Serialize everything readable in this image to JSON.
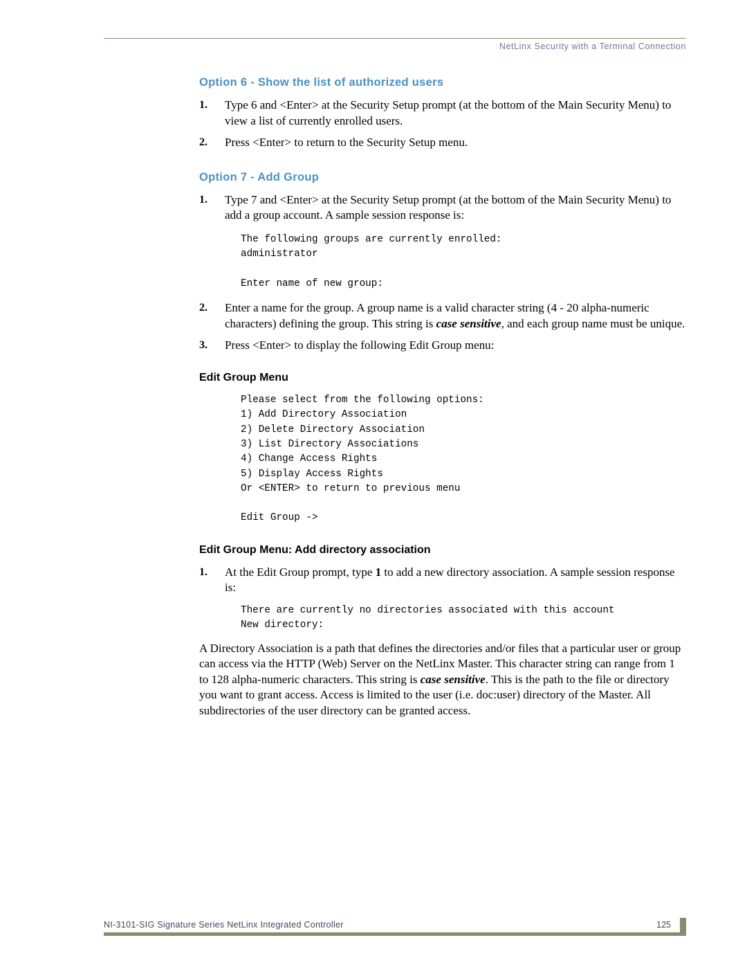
{
  "header": {
    "running_head": "NetLinx Security with a Terminal Connection"
  },
  "sections": {
    "option6": {
      "title": "Option 6 - Show the list of authorized users",
      "steps": [
        {
          "num": "1.",
          "text": "Type 6 and <Enter> at the Security Setup prompt (at the bottom of the Main Security Menu) to view a list of currently enrolled users."
        },
        {
          "num": "2.",
          "text": "Press <Enter> to return to the Security Setup menu."
        }
      ]
    },
    "option7": {
      "title": "Option 7 - Add Group",
      "step1": {
        "num": "1.",
        "text": "Type 7 and <Enter> at the Security Setup prompt (at the bottom of the Main Security Menu) to add a group account. A sample session response is:"
      },
      "terminal1": "The following groups are currently enrolled:\nadministrator\n\nEnter name of new group:",
      "step2": {
        "num": "2.",
        "text_before": "Enter a name for the group. A group name is a valid character string (4 - 20 alpha-numeric characters) defining the group. This string is ",
        "emphasis": "case sensitive",
        "text_after": ", and each group name must be unique."
      },
      "step3": {
        "num": "3.",
        "text": "Press <Enter> to display the following Edit Group menu:"
      }
    },
    "edit_group_menu": {
      "title": "Edit Group Menu",
      "terminal": "Please select from the following options:\n1) Add Directory Association\n2) Delete Directory Association\n3) List Directory Associations\n4) Change Access Rights\n5) Display Access Rights\nOr <ENTER> to return to previous menu\n\nEdit Group ->"
    },
    "add_directory_association": {
      "title": "Edit Group Menu: Add directory association",
      "step1": {
        "num": "1.",
        "text_before": "At the Edit Group prompt, type ",
        "emphasis": "1",
        "text_after": " to add a new directory association. A sample session response is:"
      },
      "terminal": "There are currently no directories associated with this account\nNew directory:",
      "paragraph_before": "A Directory Association is a path that defines the directories and/or files that a particular user or group can access via the HTTP (Web) Server on the NetLinx Master. This character string can range from 1 to 128 alpha-numeric characters. This string is ",
      "paragraph_emphasis": "case sensitive",
      "paragraph_after": ". This is the path to the file or directory you want to grant access. Access is limited to the user (i.e. doc:user) directory of the Master. All subdirectories of the user directory can be granted access."
    }
  },
  "footer": {
    "product": "NI-3101-SIG Signature Series NetLinx Integrated Controller",
    "page_number": "125"
  },
  "colors": {
    "heading_blue": "#4a90c4",
    "rule_olive": "#8a8a6e",
    "header_text": "#6b7a8f"
  }
}
